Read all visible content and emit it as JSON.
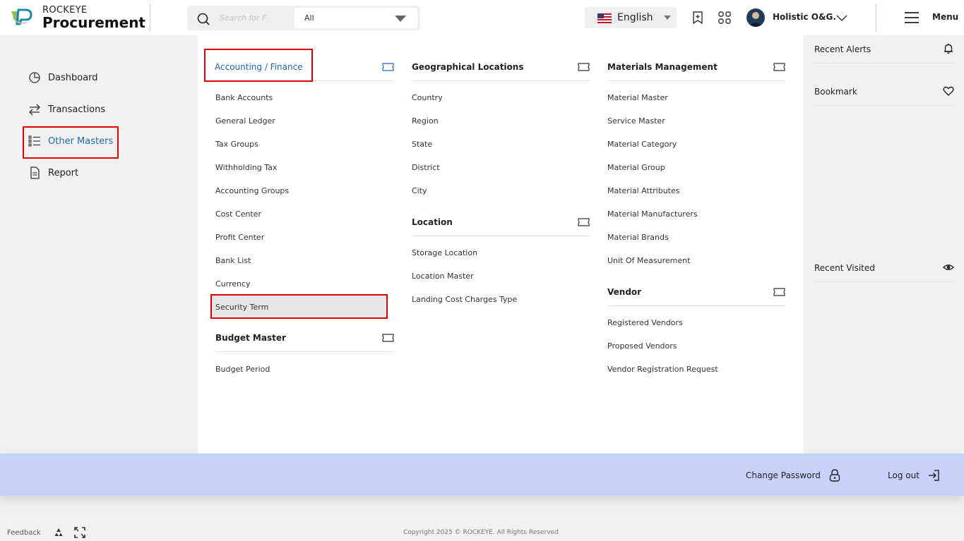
{
  "brand": {
    "small": "ROCKEYE",
    "big": "Procurement"
  },
  "search": {
    "placeholder": "Search for F",
    "scope": "All"
  },
  "language": {
    "label": "English"
  },
  "user": {
    "name": "Holistic O&G."
  },
  "menu": {
    "label": "Menu"
  },
  "nav": [
    {
      "label": "Dashboard",
      "icon": "pie-chart-icon"
    },
    {
      "label": "Transactions",
      "icon": "swap-arrows-icon"
    },
    {
      "label": "Other Masters",
      "icon": "list-icon"
    },
    {
      "label": "Report",
      "icon": "document-icon"
    }
  ],
  "sections": {
    "accounting": {
      "title": "Accounting / Finance",
      "items": [
        "Bank Accounts",
        "General Ledger",
        "Tax Groups",
        "Withholding Tax",
        "Accounting Groups",
        "Cost Center",
        "Profit Center",
        "Bank List",
        "Currency",
        "Security Term"
      ]
    },
    "budget": {
      "title": "Budget Master",
      "items": [
        "Budget Period"
      ]
    },
    "geo": {
      "title": "Geographical Locations",
      "items": [
        "Country",
        "Region",
        "State",
        "District",
        "City"
      ]
    },
    "location": {
      "title": "Location",
      "items": [
        "Storage Location",
        "Location Master",
        "Landing Cost Charges Type"
      ]
    },
    "materials": {
      "title": "Materials Management",
      "items": [
        "Material Master",
        "Service Master",
        "Material Category",
        "Material Group",
        "Material Attributes",
        "Material Manufacturers",
        "Material Brands",
        "Unit Of Measurement"
      ]
    },
    "vendor": {
      "title": "Vendor",
      "items": [
        "Registered Vendors",
        "Proposed Vendors",
        "Vendor Registration Request"
      ]
    }
  },
  "right": {
    "alerts": "Recent Alerts",
    "bookmark": "Bookmark",
    "visited": "Recent Visited"
  },
  "footer": {
    "change_password": "Change Password",
    "logout": "Log out",
    "feedback": "Feedback",
    "copyright": "Copyright 2025 © ROCKEYE. All Rights Reserved"
  },
  "colors": {
    "accent": "#1b6ab8",
    "highlight": "#e10000",
    "band": "#c6d2f9"
  }
}
